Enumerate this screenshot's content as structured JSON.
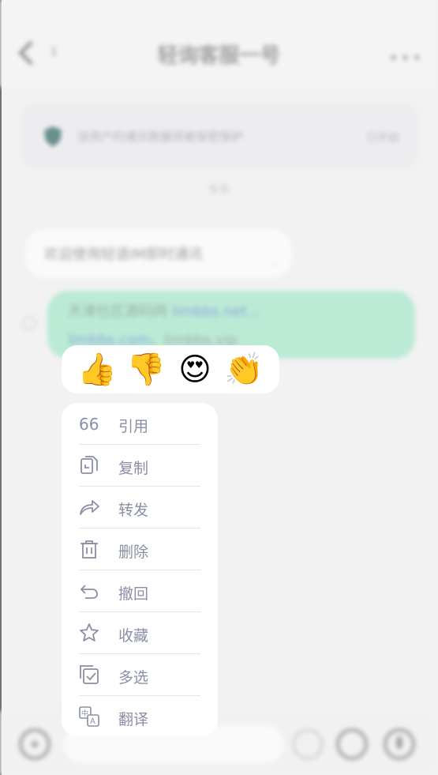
{
  "header": {
    "back_count": "1",
    "title": "轻询客服一号",
    "more": "•••"
  },
  "notice": {
    "text": "该用户的通讯数据将被保密保护",
    "link": "已开启"
  },
  "time_separator": "今天",
  "messages": {
    "incoming": {
      "text": "欢迎使用轻语IM即时通讯",
      "time": "..."
    },
    "outgoing": {
      "line1_prefix": "天津社区源码网 ",
      "line1_link": "limbbs.net...",
      "line2_link": "limbbs.com",
      "line2_suffix": "，limbbs.vip",
      "time": "..."
    }
  },
  "reactions": [
    {
      "emoji": "👍",
      "name": "thumbs-up"
    },
    {
      "emoji": "👎",
      "name": "thumbs-down"
    },
    {
      "emoji": "😍",
      "name": "heart-eyes"
    },
    {
      "emoji": "👏",
      "name": "clapping-hands"
    }
  ],
  "menu": {
    "items": [
      {
        "label": "引用",
        "icon": "quote-icon"
      },
      {
        "label": "复制",
        "icon": "copy-icon"
      },
      {
        "label": "转发",
        "icon": "forward-icon"
      },
      {
        "label": "删除",
        "icon": "trash-icon"
      },
      {
        "label": "撤回",
        "icon": "undo-icon"
      },
      {
        "label": "收藏",
        "icon": "star-icon"
      },
      {
        "label": "多选",
        "icon": "multiselect-icon"
      },
      {
        "label": "翻译",
        "icon": "translate-icon"
      }
    ]
  },
  "colors": {
    "menu_text": "#8a8fa6",
    "outgoing_bubble": "#9fe8c7",
    "accent_link": "#5a7ccf"
  }
}
